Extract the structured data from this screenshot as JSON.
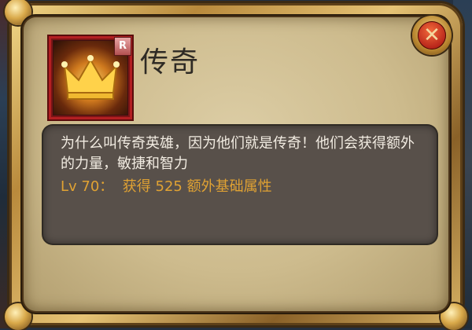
{
  "hero": {
    "title": "传奇",
    "rank_badge": "R",
    "icon": "crown-icon"
  },
  "description": "为什么叫传奇英雄，因为他们就是传奇！他们会获得额外的力量，敏捷和智力",
  "bonus": {
    "level_label": "Lv 70：",
    "text": "获得 525 额外基础属性"
  },
  "close_button": {
    "icon": "close-icon",
    "glyph": "✕"
  },
  "colors": {
    "bonus_text": "#e0a233",
    "desc_text": "#f2ece2",
    "frame_gold": "#d7b264",
    "badge_red": "#b31f22"
  }
}
